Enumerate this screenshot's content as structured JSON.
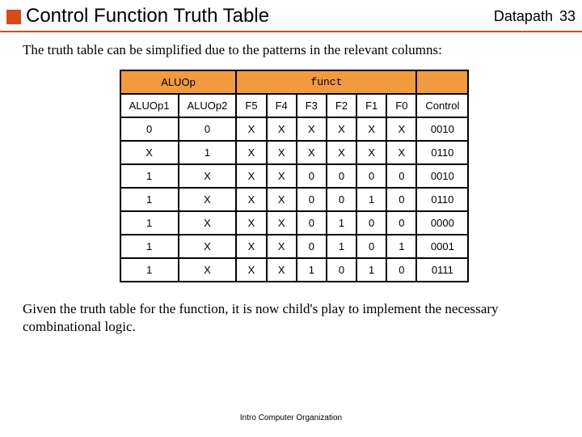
{
  "header": {
    "title": "Control Function Truth Table",
    "section": "Datapath",
    "page": "33"
  },
  "lead": "The truth table can be simplified due to the patterns in the relevant columns:",
  "table": {
    "group1": "ALUOp",
    "group2": "funct",
    "cols": {
      "c0": "ALUOp1",
      "c1": "ALUOp2",
      "c2": "F5",
      "c3": "F4",
      "c4": "F3",
      "c5": "F2",
      "c6": "F1",
      "c7": "F0",
      "c8": "Control"
    },
    "rows": [
      {
        "c0": "0",
        "c1": "0",
        "c2": "X",
        "c3": "X",
        "c4": "X",
        "c5": "X",
        "c6": "X",
        "c7": "X",
        "c8": "0010"
      },
      {
        "c0": "X",
        "c1": "1",
        "c2": "X",
        "c3": "X",
        "c4": "X",
        "c5": "X",
        "c6": "X",
        "c7": "X",
        "c8": "0110"
      },
      {
        "c0": "1",
        "c1": "X",
        "c2": "X",
        "c3": "X",
        "c4": "0",
        "c5": "0",
        "c6": "0",
        "c7": "0",
        "c8": "0010"
      },
      {
        "c0": "1",
        "c1": "X",
        "c2": "X",
        "c3": "X",
        "c4": "0",
        "c5": "0",
        "c6": "1",
        "c7": "0",
        "c8": "0110"
      },
      {
        "c0": "1",
        "c1": "X",
        "c2": "X",
        "c3": "X",
        "c4": "0",
        "c5": "1",
        "c6": "0",
        "c7": "0",
        "c8": "0000"
      },
      {
        "c0": "1",
        "c1": "X",
        "c2": "X",
        "c3": "X",
        "c4": "0",
        "c5": "1",
        "c6": "0",
        "c7": "1",
        "c8": "0001"
      },
      {
        "c0": "1",
        "c1": "X",
        "c2": "X",
        "c3": "X",
        "c4": "1",
        "c5": "0",
        "c6": "1",
        "c7": "0",
        "c8": "0111"
      }
    ]
  },
  "after": "Given the truth table for the function, it is now child's play to implement the necessary combinational logic.",
  "footer": "Intro Computer Organization"
}
